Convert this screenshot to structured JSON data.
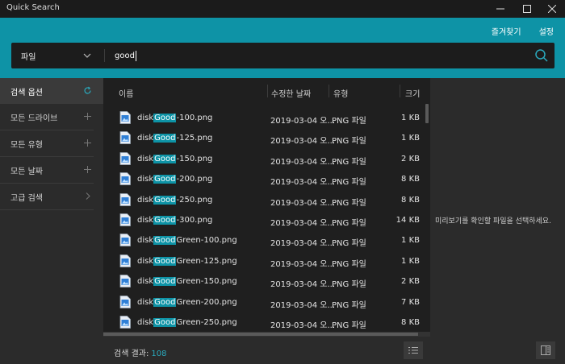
{
  "window": {
    "title": "Quick Search"
  },
  "header": {
    "favorites_label": "즐겨찾기",
    "settings_label": "설정"
  },
  "search": {
    "category": "파일",
    "query": "good"
  },
  "sidebar": {
    "items": [
      {
        "label": "검색 옵션",
        "icon": "refresh-icon"
      },
      {
        "label": "모든 드라이브",
        "icon": "plus-icon"
      },
      {
        "label": "모든 유형",
        "icon": "plus-icon"
      },
      {
        "label": "모든 날짜",
        "icon": "plus-icon"
      },
      {
        "label": "고급 검색",
        "icon": "chevron-right-icon"
      }
    ]
  },
  "columns": {
    "name": "이름",
    "modified": "수정한 날짜",
    "type": "유형",
    "size": "크기"
  },
  "files": [
    {
      "pre": "disk",
      "match": "Good",
      "post": "-100.png",
      "date": "2019-03-04 오...",
      "type": "PNG 파일",
      "size": "1 KB"
    },
    {
      "pre": "disk",
      "match": "Good",
      "post": "-125.png",
      "date": "2019-03-04 오...",
      "type": "PNG 파일",
      "size": "1 KB"
    },
    {
      "pre": "disk",
      "match": "Good",
      "post": "-150.png",
      "date": "2019-03-04 오...",
      "type": "PNG 파일",
      "size": "2 KB"
    },
    {
      "pre": "disk",
      "match": "Good",
      "post": "-200.png",
      "date": "2019-03-04 오...",
      "type": "PNG 파일",
      "size": "8 KB"
    },
    {
      "pre": "disk",
      "match": "Good",
      "post": "-250.png",
      "date": "2019-03-04 오...",
      "type": "PNG 파일",
      "size": "8 KB"
    },
    {
      "pre": "disk",
      "match": "Good",
      "post": "-300.png",
      "date": "2019-03-04 오...",
      "type": "PNG 파일",
      "size": "14 KB"
    },
    {
      "pre": "disk",
      "match": "Good",
      "post": "Green-100.png",
      "date": "2019-03-04 오...",
      "type": "PNG 파일",
      "size": "1 KB"
    },
    {
      "pre": "disk",
      "match": "Good",
      "post": "Green-125.png",
      "date": "2019-03-04 오...",
      "type": "PNG 파일",
      "size": "1 KB"
    },
    {
      "pre": "disk",
      "match": "Good",
      "post": "Green-150.png",
      "date": "2019-03-04 오...",
      "type": "PNG 파일",
      "size": "2 KB"
    },
    {
      "pre": "disk",
      "match": "Good",
      "post": "Green-200.png",
      "date": "2019-03-04 오...",
      "type": "PNG 파일",
      "size": "7 KB"
    },
    {
      "pre": "disk",
      "match": "Good",
      "post": "Green-250.png",
      "date": "2019-03-04 오...",
      "type": "PNG 파일",
      "size": "8 KB"
    }
  ],
  "status": {
    "label": "검색 결과:",
    "count": "108"
  },
  "preview": {
    "message": "미리보기를 확인할 파일을 선택하세요."
  },
  "colors": {
    "accent": "#0e93a6",
    "panel": "#2b2b2b",
    "background": "#1f1f1f"
  }
}
